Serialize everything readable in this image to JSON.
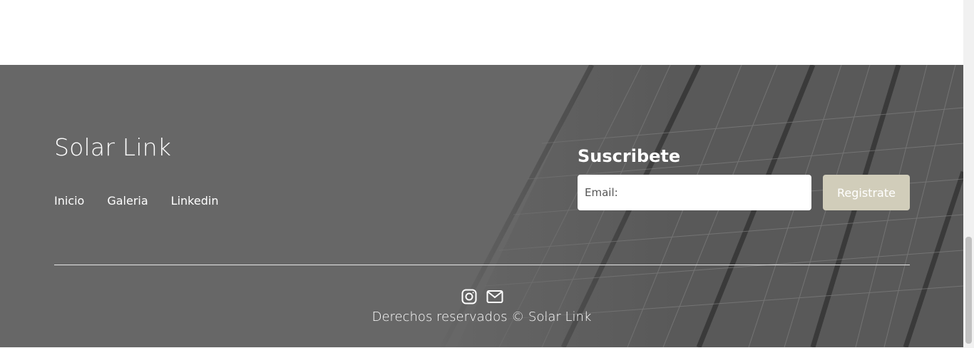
{
  "footer": {
    "brand": "Solar Link",
    "nav": [
      {
        "label": "Inicio"
      },
      {
        "label": "Galeria"
      },
      {
        "label": "Linkedin"
      }
    ],
    "subscribe": {
      "title": "Suscribete",
      "email_placeholder": "Email:",
      "email_value": "",
      "button_label": "Registrate"
    },
    "social_icons": [
      "instagram-icon",
      "mail-icon"
    ],
    "copyright": "Derechos reservados © Solar Link"
  },
  "colors": {
    "footer_bg": "#676767",
    "button_bg": "#d1cdba",
    "text": "#ffffff"
  }
}
